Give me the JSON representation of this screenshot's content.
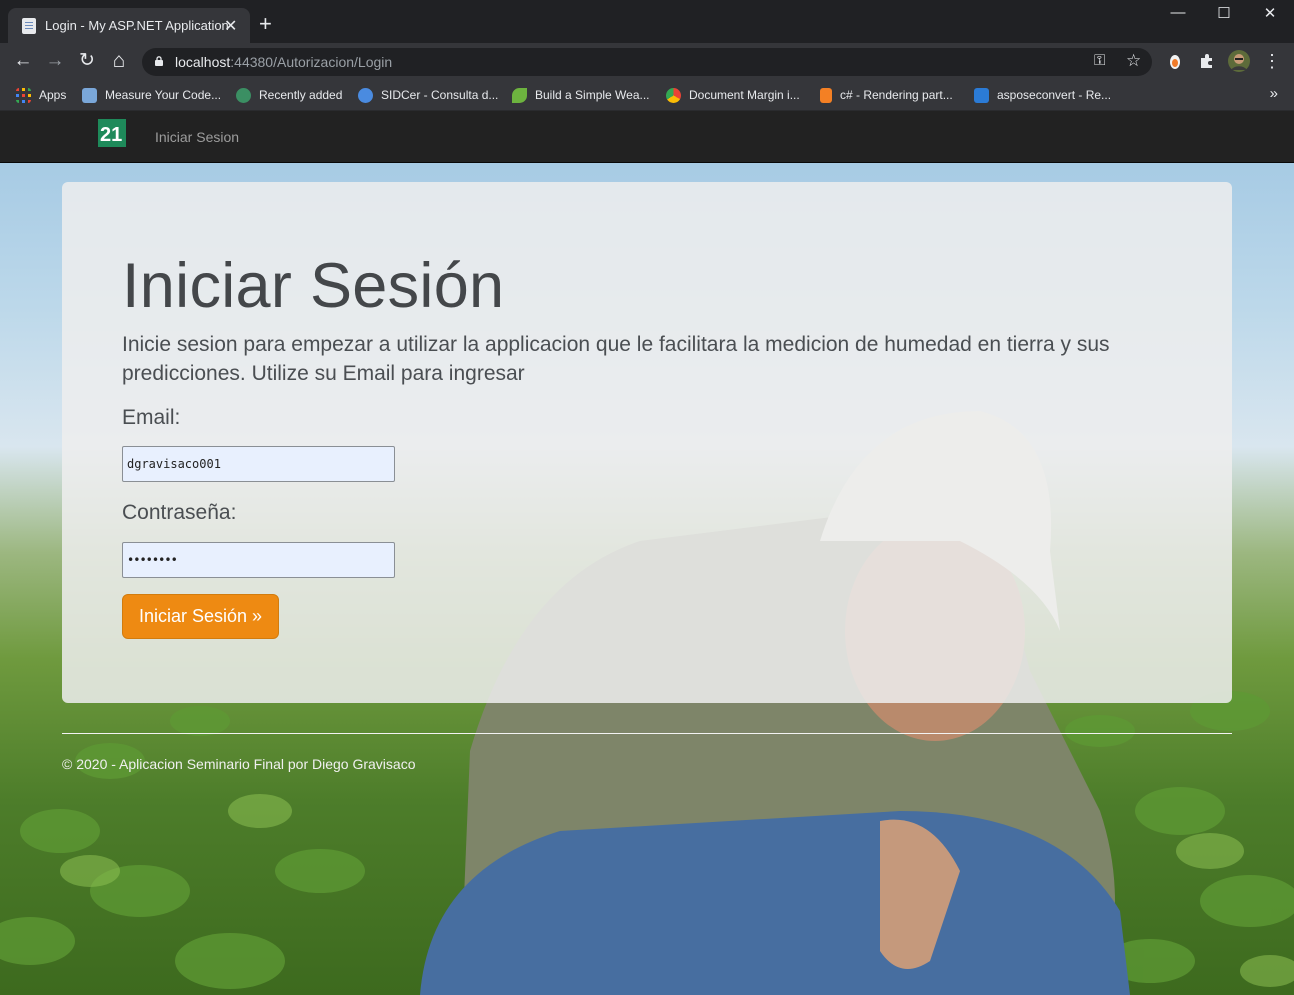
{
  "browser": {
    "tab_title": "Login - My ASP.NET Application",
    "tab_close": "✕",
    "new_tab": "+",
    "window_controls": {
      "minimize": "—",
      "maximize": "☐",
      "close": "✕"
    },
    "nav": {
      "back": "←",
      "forward": "→",
      "reload": "↻",
      "home": "⌂"
    },
    "url_host": "localhost",
    "url_rest": ":44380/Autorizacion/Login",
    "omnibox_icons": {
      "key": "⚿",
      "star": "☆"
    },
    "menu_icon": "⋮",
    "bookmarks": [
      {
        "label": "Apps",
        "icon": "apps-grid-icon",
        "color": "#ea4335"
      },
      {
        "label": "Measure Your Code...",
        "icon": "tools-icon",
        "color": "#7aa7d9"
      },
      {
        "label": "Recently added",
        "icon": "recent-icon",
        "color": "#3b8f63"
      },
      {
        "label": "SIDCer - Consulta d...",
        "icon": "check-badge-icon",
        "color": "#4a8be0"
      },
      {
        "label": "Build a Simple Wea...",
        "icon": "leaf-icon",
        "color": "#6db33f"
      },
      {
        "label": "Document Margin i...",
        "icon": "chrome-icon",
        "color": "#e3a82b"
      },
      {
        "label": "c# - Rendering part...",
        "icon": "stackoverflow-icon",
        "color": "#f48024"
      },
      {
        "label": "asposeconvert - Re...",
        "icon": "azure-devops-icon",
        "color": "#2b7bd6"
      }
    ],
    "bookmarks_more": "»"
  },
  "site": {
    "nav_link": "Iniciar Sesion",
    "brand_color": "#1e8a5a",
    "navbar_color": "#222222"
  },
  "login": {
    "title": "Iniciar Sesión",
    "lead": "Inicie sesion para empezar a utilizar la applicacion que le facilitara la medicion de humedad en tierra y sus predicciones. Utilize su Email para ingresar",
    "email_label": "Email:",
    "email_value": "dgravisaco001",
    "password_label": "Contraseña:",
    "password_value": "••••••••",
    "submit_label": "Iniciar Sesión »",
    "button_color": "#ee8a12"
  },
  "footer": {
    "text": "© 2020 - Aplicacion Seminario Final por Diego Gravisaco"
  }
}
